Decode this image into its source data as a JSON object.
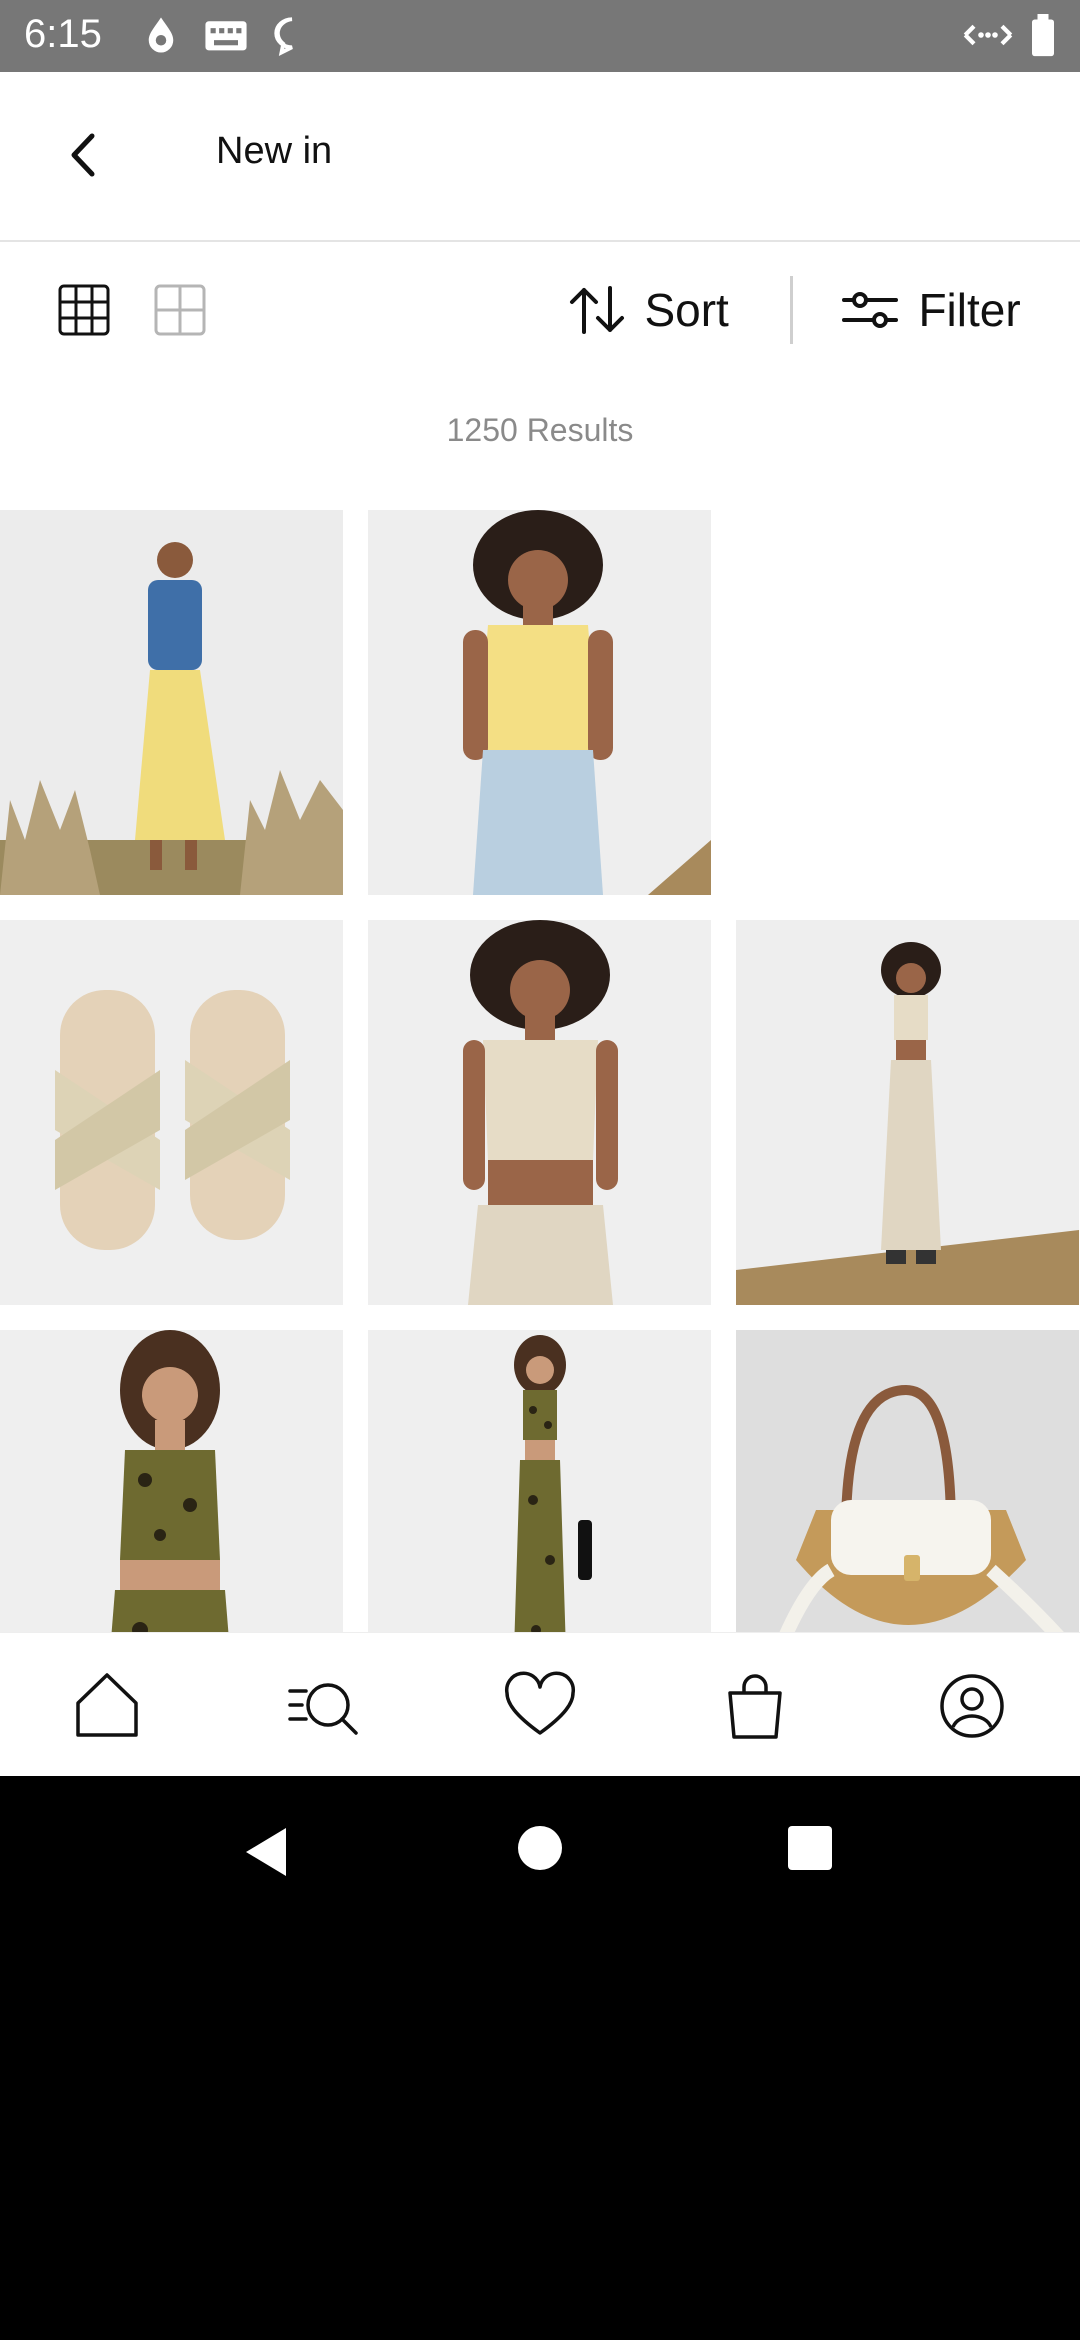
{
  "status_bar": {
    "time": "6:15"
  },
  "header": {
    "title": "New in"
  },
  "toolbar": {
    "sort_label": "Sort",
    "filter_label": "Filter"
  },
  "results": {
    "count_text": "1250 Results"
  },
  "products": [
    {
      "desc": "model in denim vest and yellow maxi skirt"
    },
    {
      "desc": "model in yellow waistcoat and light jeans"
    },
    {
      "desc": "cream woven cross-strap sandals"
    },
    {
      "desc": "crochet crop top and skirt close-up"
    },
    {
      "desc": "crochet crop top and maxi skirt full length"
    },
    {
      "desc": "leopard print cami and skirt close-up"
    },
    {
      "desc": "leopard print cami and maxi skirt full length"
    },
    {
      "desc": "woven straw crossbody bag"
    }
  ]
}
